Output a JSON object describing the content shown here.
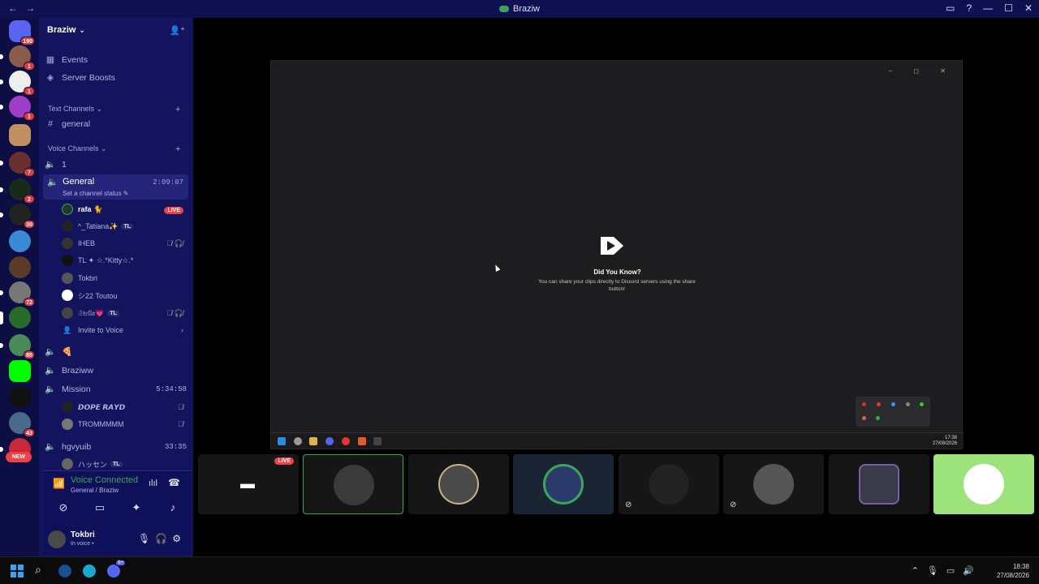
{
  "titlebar": {
    "title": "Braziw",
    "back": "←",
    "forward": "→"
  },
  "servers": {
    "home_badge": "190",
    "items": [
      {
        "badge": "1"
      },
      {
        "badge": "1"
      },
      {
        "badge": "1"
      },
      {
        "badge": ""
      },
      {
        "badge": "7"
      },
      {
        "badge": "2"
      },
      {
        "badge": "30"
      },
      {
        "badge": ""
      },
      {
        "badge": ""
      },
      {
        "badge": "72"
      },
      {
        "badge": ""
      },
      {
        "badge": "85"
      },
      {
        "badge": ""
      },
      {
        "badge": ""
      },
      {
        "badge": "43"
      },
      {
        "badge": "NEW"
      }
    ]
  },
  "sidebar": {
    "guild_name": "Braziw",
    "events": "Events",
    "server_boosts": "Server Boosts",
    "text_channels": "Text Channels",
    "general_text": "general",
    "voice_channels": "Voice Channels",
    "vc_one": "1",
    "vc_general": "General",
    "vc_general_time": "2:09:07",
    "vc_general_status": "Set a channel status",
    "live_label": "LIVE",
    "members": [
      {
        "name": "rafa 🐈",
        "tag": "",
        "icons": ""
      },
      {
        "name": "^_Tatiana✨",
        "tag": "TL",
        "icons": ""
      },
      {
        "name": "IHEB",
        "tag": "",
        "icons": "🎙̸ 🎧̸"
      },
      {
        "name": "TL ✦ ☆.*Kitty☆.*",
        "tag": "",
        "icons": ""
      },
      {
        "name": "Tokbri",
        "tag": "",
        "icons": ""
      },
      {
        "name": "シ22 Toutou",
        "tag": "",
        "icons": ""
      },
      {
        "name": "𝔖𝔱𝔢𝔩𝔩𝔞💗",
        "tag": "TL",
        "icons": "🎙̸ 🎧̸"
      }
    ],
    "invite": "Invite to Voice",
    "vc_pizza": "🍕",
    "vc_braziww": "Braziww",
    "vc_mission": "Mission",
    "vc_mission_time": "5:34:58",
    "mission_members": [
      {
        "name": "𝘿𝙊𝙋𝙀 𝙍𝘼𝙔𝘿",
        "icons": "🎙̸"
      },
      {
        "name": "TROMMMMM",
        "icons": "🎙̸"
      }
    ],
    "vc_hgvyuib": "hgvyuib",
    "vc_hgvyuib_time": "33:35",
    "hgv_member": {
      "name": "ハッセン",
      "tag": "TL"
    }
  },
  "voice_panel": {
    "title": "Voice Connected",
    "sub": "General / Braziw",
    "user_name": "Tokbri",
    "user_status": "In voice •"
  },
  "stage": {
    "dyk_title": "Did You Know?",
    "dyk_body": "You can share your clips directly to Discord servers using the share button!",
    "inner_time": "17:38",
    "inner_date": "27/08/2026",
    "live_label": "LIVE"
  },
  "taskbar": {
    "time": "18:38",
    "date": "27/08/2026",
    "discord_badge": "9+"
  }
}
